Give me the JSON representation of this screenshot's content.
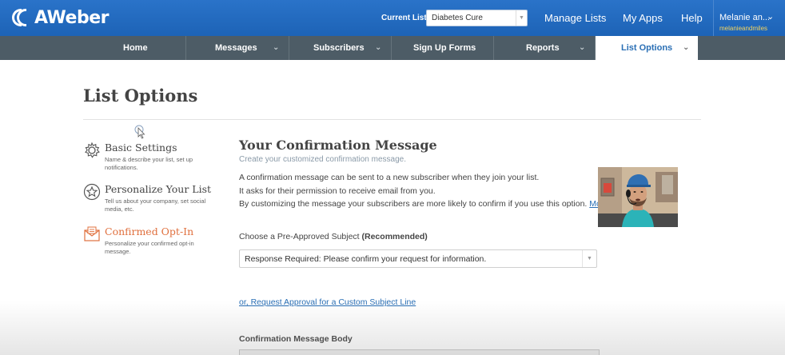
{
  "topbar": {
    "logo_text": "AWeber",
    "current_list_label": "Current List:",
    "current_list_value": "Diabetes Cure",
    "links": [
      "Manage Lists",
      "My Apps",
      "Help"
    ],
    "user_name": "Melanie an...",
    "user_sub": "melanieandmiles"
  },
  "nav": [
    {
      "label": "Home"
    },
    {
      "label": "Messages"
    },
    {
      "label": "Subscribers"
    },
    {
      "label": "Sign Up Forms"
    },
    {
      "label": "Reports"
    },
    {
      "label": "List Options"
    }
  ],
  "page_title": "List Options",
  "sidebar": [
    {
      "title": "Basic Settings",
      "desc": "Name & describe your list, set up notifications.",
      "icon": "gear-icon"
    },
    {
      "title": "Personalize Your List",
      "desc": "Tell us about your company, set social media, etc.",
      "icon": "star-icon"
    },
    {
      "title": "Confirmed Opt-In",
      "desc": "Personalize your confirmed opt-in message.",
      "icon": "envelope-icon"
    }
  ],
  "main": {
    "title": "Your Confirmation Message",
    "subtitle": "Create your customized confirmation message.",
    "para1": "A confirmation message can be sent to a new subscriber when they join your list.",
    "para2": "It asks for their permission to receive email from you.",
    "para3": "By customizing the message your subscribers are more likely to confirm if you use this option.",
    "para3_more": "Mo",
    "subject_label": "Choose a Pre-Approved Subject",
    "subject_label_bold": "(Recommended)",
    "subject_value": "Response Required: Please confirm your request for information.",
    "custom_link": "or, Request Approval for a Custom Subject Line",
    "body_label": "Confirmation Message Body"
  },
  "colors": {
    "topbar": "#1d63b6",
    "navbar": "#4d5c66",
    "accent_link": "#2a6fb5",
    "active_orange": "#e0703e"
  }
}
